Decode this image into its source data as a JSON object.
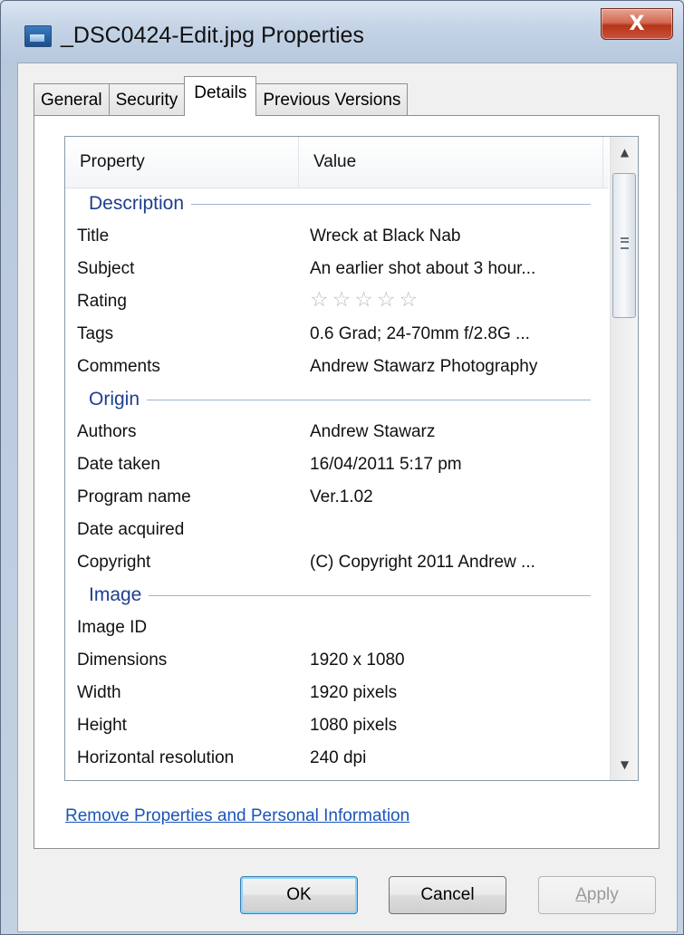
{
  "window": {
    "title": "_DSC0424-Edit.jpg Properties",
    "close_label": "X"
  },
  "tabs": [
    {
      "label": "General",
      "active": false
    },
    {
      "label": "Security",
      "active": false
    },
    {
      "label": "Details",
      "active": true
    },
    {
      "label": "Previous Versions",
      "active": false
    }
  ],
  "list": {
    "header": {
      "property": "Property",
      "value": "Value"
    },
    "groups": {
      "description": {
        "label": "Description",
        "rows": {
          "title": {
            "name": "Title",
            "value": "Wreck at Black Nab"
          },
          "subject": {
            "name": "Subject",
            "value": "An earlier shot about 3 hour..."
          },
          "rating": {
            "name": "Rating",
            "stars_filled": 0,
            "stars_total": 5
          },
          "tags": {
            "name": "Tags",
            "value": "0.6 Grad; 24-70mm f/2.8G ..."
          },
          "comments": {
            "name": "Comments",
            "value": "Andrew Stawarz Photography"
          }
        }
      },
      "origin": {
        "label": "Origin",
        "rows": {
          "authors": {
            "name": "Authors",
            "value": "Andrew Stawarz"
          },
          "date_taken": {
            "name": "Date taken",
            "value": "16/04/2011 5:17 pm"
          },
          "program_name": {
            "name": "Program name",
            "value": "Ver.1.02"
          },
          "date_acquired": {
            "name": "Date acquired",
            "value": ""
          },
          "copyright": {
            "name": "Copyright",
            "value": "(C) Copyright 2011 Andrew ..."
          }
        }
      },
      "image": {
        "label": "Image",
        "rows": {
          "image_id": {
            "name": "Image ID",
            "value": ""
          },
          "dimensions": {
            "name": "Dimensions",
            "value": "1920 x 1080"
          },
          "width": {
            "name": "Width",
            "value": "1920 pixels"
          },
          "height": {
            "name": "Height",
            "value": "1080 pixels"
          },
          "horizontal_resolution": {
            "name": "Horizontal resolution",
            "value": "240 dpi"
          }
        }
      }
    }
  },
  "link": {
    "remove_properties": "Remove Properties and Personal Information"
  },
  "buttons": {
    "ok": "OK",
    "cancel": "Cancel",
    "apply_first": "A",
    "apply_rest": "pply"
  },
  "colors": {
    "link": "#1a55b8",
    "group_header": "#1e3f8e",
    "close_button": "#c8523a"
  },
  "icons": {
    "title": "image-file-icon",
    "close": "close-icon",
    "scroll_up": "chevron-up-icon",
    "scroll_down": "chevron-down-icon",
    "rating": "star-icon"
  }
}
